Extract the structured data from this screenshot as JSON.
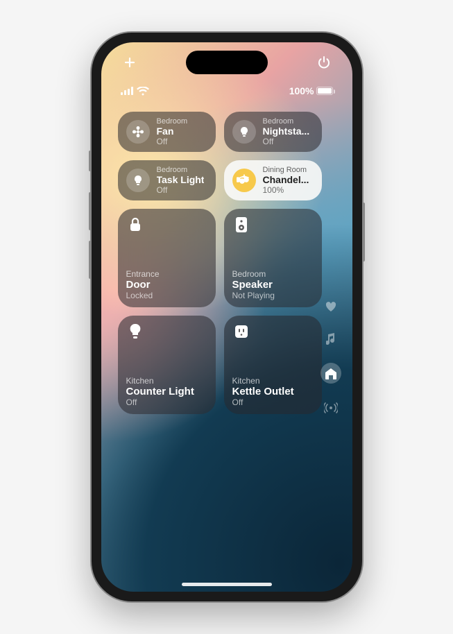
{
  "topbar": {
    "add_icon": "plus",
    "power_icon": "power"
  },
  "status": {
    "battery_percent": "100%"
  },
  "tiles": [
    {
      "room": "Bedroom",
      "name": "Fan",
      "status": "Off",
      "icon": "fan",
      "size": "small",
      "style": "dark"
    },
    {
      "room": "Bedroom",
      "name": "Nightsta...",
      "status": "Off",
      "icon": "bulb",
      "size": "small",
      "style": "dark"
    },
    {
      "room": "Bedroom",
      "name": "Task Light",
      "status": "Off",
      "icon": "bulb",
      "size": "small",
      "style": "dark"
    },
    {
      "room": "Dining Room",
      "name": "Chandel...",
      "status": "100%",
      "icon": "chandelier",
      "size": "small",
      "style": "light"
    },
    {
      "room": "Entrance",
      "name": "Door",
      "status": "Locked",
      "icon": "lock",
      "size": "large",
      "style": "dark"
    },
    {
      "room": "Bedroom",
      "name": "Speaker",
      "status": "Not Playing",
      "icon": "speaker",
      "size": "large",
      "style": "dark"
    },
    {
      "room": "Kitchen",
      "name": "Counter Light",
      "status": "Off",
      "icon": "bulb",
      "size": "large",
      "style": "dark"
    },
    {
      "room": "Kitchen",
      "name": "Kettle Outlet",
      "status": "Off",
      "icon": "outlet",
      "size": "large",
      "style": "dark"
    }
  ],
  "siderail": {
    "items": [
      "heart",
      "music",
      "home",
      "broadcast"
    ],
    "active": "home"
  }
}
